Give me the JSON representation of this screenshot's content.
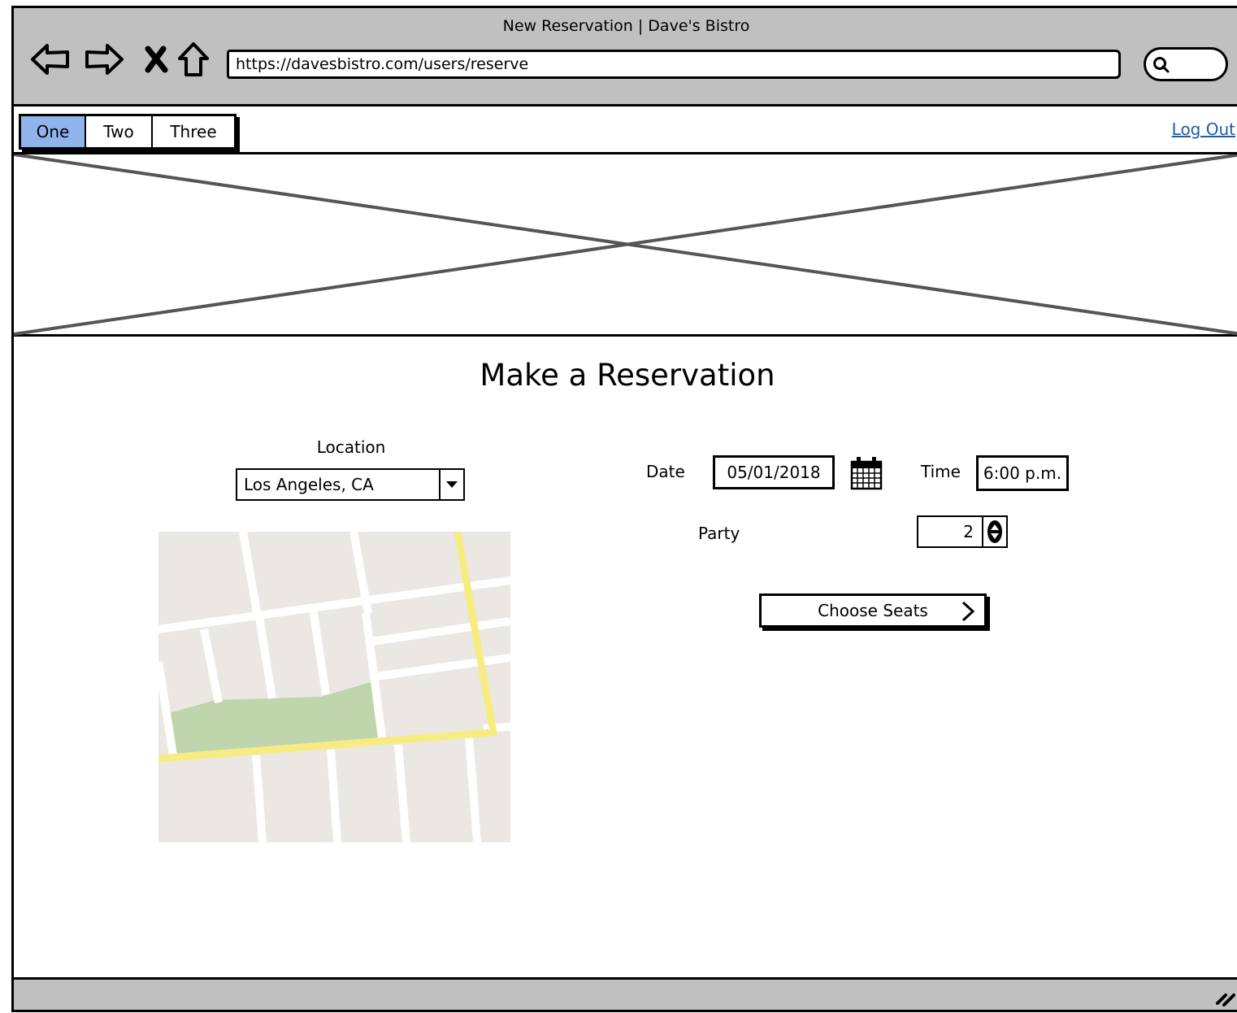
{
  "browser": {
    "window_title": "New Reservation | Dave's Bistro",
    "url": "https://davesbistro.com/users/reserve",
    "nav_icons": [
      "back-arrow-icon",
      "forward-arrow-icon",
      "stop-x-icon",
      "home-icon"
    ],
    "search_icon": "search-icon"
  },
  "nav": {
    "tabs": [
      {
        "label": "One",
        "active": true
      },
      {
        "label": "Two",
        "active": false
      },
      {
        "label": "Three",
        "active": false
      }
    ],
    "logout_label": "Log Out"
  },
  "hero": {
    "type": "image-placeholder"
  },
  "main": {
    "title": "Make a Reservation",
    "location": {
      "label": "Location",
      "selected": "Los Angeles, CA"
    },
    "date": {
      "label": "Date",
      "value": "05/01/2018",
      "icon": "calendar-icon"
    },
    "time": {
      "label": "Time",
      "value": "6:00 p.m."
    },
    "party": {
      "label": "Party",
      "value": "2"
    },
    "choose_seats_label": "Choose Seats"
  },
  "colors": {
    "chrome": "#c0c0c0",
    "active_tab": "#8fb3ea",
    "link": "#1f5ea8",
    "map_bg": "#ebe8e3",
    "map_road_major": "#f7ec82",
    "map_park": "#bfd6ad"
  }
}
